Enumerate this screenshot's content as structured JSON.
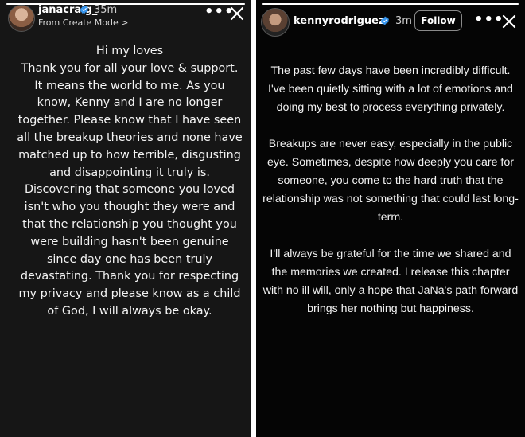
{
  "left_story": {
    "username": "janacraig_",
    "timestamp": "35m",
    "subtitle": "From Create Mode >",
    "more_icon": "•••",
    "message": "Hi my loves\nThank you for all your love & support. It means the world to me.  As you know, Kenny and I are no longer together.  Please know that I have seen all the breakup theories and none have matched up to how terrible, disgusting and disappointing it truly is. Discovering that someone you loved isn't who you thought they were and that the relationship you thought you were building hasn't been genuine since day one has been truly devastating.  Thank you for respecting my privacy and please know as a child of God, I will always be okay."
  },
  "right_story": {
    "username": "kennyrodriguez",
    "timestamp": "3m",
    "follow_label": "Follow",
    "more_icon": "•••",
    "paragraphs": [
      "The past few days have been incredibly difficult. I've been quietly sitting with a lot of emotions and doing my best to process everything privately.",
      "Breakups are never easy, especially in the public eye. Sometimes, despite how deeply you care for someone, you come to the hard truth that the relationship was not something that could last long-term.",
      "I'll always be grateful for the time we shared and the memories we created. I release this chapter with no ill will, only a hope that JaNa's path forward brings her nothing but happiness."
    ]
  },
  "icons": {
    "verified": "verified-badge-icon",
    "more": "more-options-icon",
    "close": "close-icon"
  },
  "colors": {
    "verified_badge": "#3897f0",
    "left_background": "#161616",
    "right_background": "#050505"
  }
}
